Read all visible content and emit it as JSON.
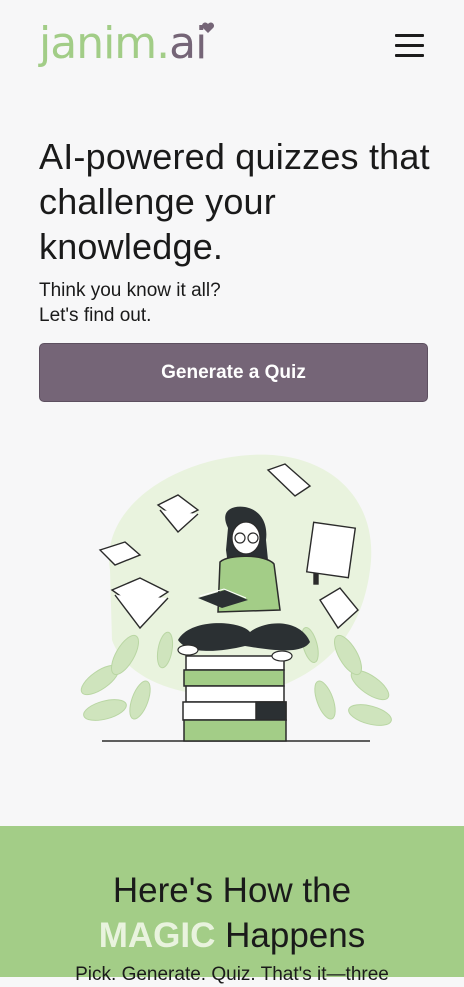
{
  "header": {
    "logo_part1": "janim.",
    "logo_part2": "ai",
    "menu_icon": "hamburger-menu-icon"
  },
  "hero": {
    "title": "AI-powered quizzes that challenge your knowledge.",
    "subtitle_line1": "Think you know it all?",
    "subtitle_line2": "Let's find out.",
    "cta_label": "Generate a Quiz"
  },
  "how": {
    "title_line1": "Here's How the",
    "title_magic": "MAGIC",
    "title_rest": " Happens",
    "subtitle": "Pick. Generate. Quiz. That's it—three"
  },
  "colors": {
    "brand_green": "#a3cd87",
    "brand_purple": "#756577",
    "background": "#f7f7f8"
  }
}
